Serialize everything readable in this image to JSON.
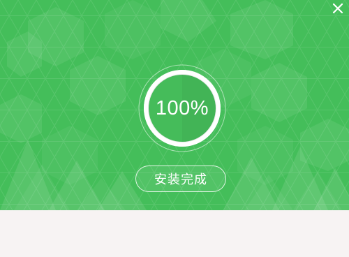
{
  "window": {
    "close_icon": "close-icon"
  },
  "progress": {
    "text": "100%",
    "value": 1.0
  },
  "status": {
    "label": "安装完成"
  },
  "colors": {
    "banner_green": "#44be5a",
    "footer_bg": "#f7f3f3",
    "ring_white": "#ffffff"
  }
}
